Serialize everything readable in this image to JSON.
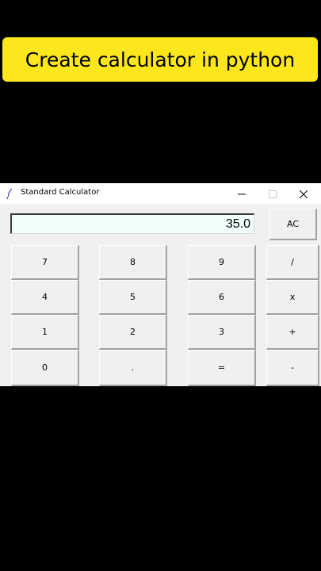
{
  "banner": {
    "title": "Create calculator in python",
    "color": "#fbe71c"
  },
  "window": {
    "title": "Standard Calculator",
    "app_icon": "feather-icon",
    "controls": {
      "minimize": "minimize-icon",
      "maximize": "maximize-icon",
      "close": "close-icon"
    }
  },
  "display": {
    "value": "35.0",
    "background": "#f0fffc"
  },
  "buttons": {
    "clear": "AC",
    "divide": "/",
    "multiply": "x",
    "add": "+",
    "subtract": "-",
    "seven": "7",
    "eight": "8",
    "nine": "9",
    "four": "4",
    "five": "5",
    "six": "6",
    "one": "1",
    "two": "2",
    "three": "3",
    "zero": "0",
    "dot": ".",
    "equals": "="
  }
}
